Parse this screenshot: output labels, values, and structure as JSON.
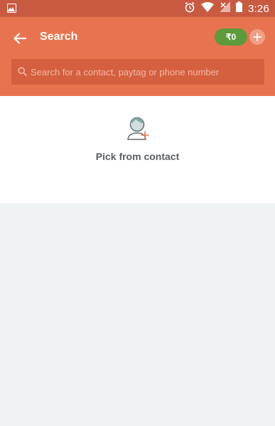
{
  "status_bar": {
    "time": "3:26",
    "icons": [
      "image-icon",
      "alarm-icon",
      "wifi-icon",
      "signal-icon",
      "battery-icon"
    ]
  },
  "app_bar": {
    "title": "Search",
    "balance": "₹0",
    "accent_color": "#e8744f",
    "balance_color": "#5d9a3b"
  },
  "search": {
    "placeholder": "Search for a contact, paytag or phone number"
  },
  "contact_picker": {
    "label": "Pick from contact",
    "icon": "add-contact-icon"
  }
}
